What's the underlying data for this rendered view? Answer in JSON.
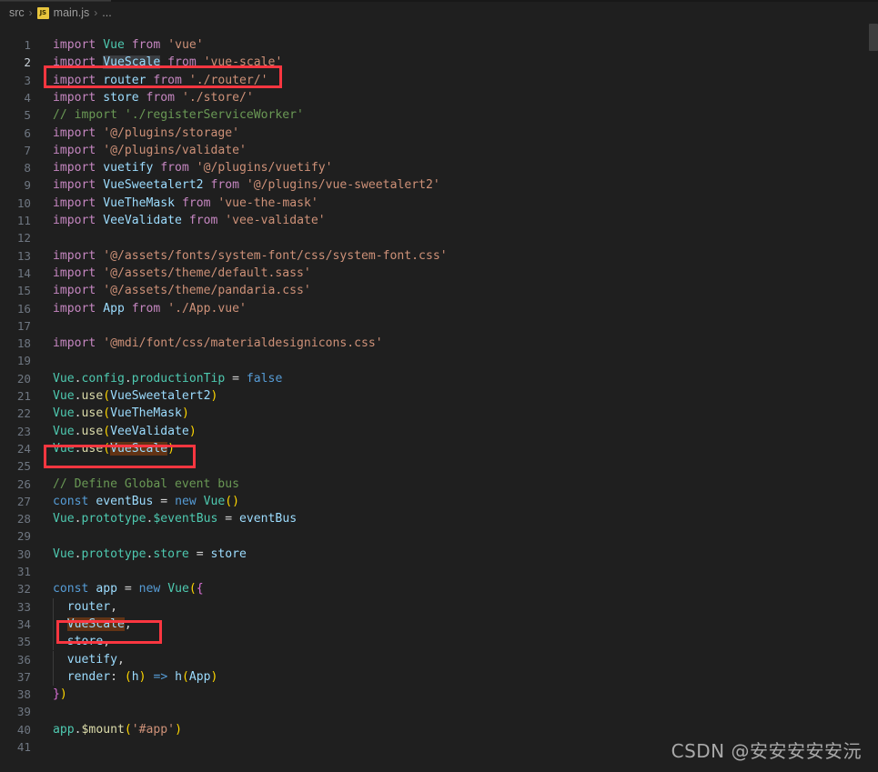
{
  "window": {
    "background_color": "#1f1f1f",
    "theme": "Dark+ (VS Code)"
  },
  "tabs": {
    "active_tab_label": "main.js"
  },
  "breadcrumb": {
    "items": [
      {
        "label": "src",
        "icon": null
      },
      {
        "label": "main.js",
        "icon": "js-file-icon"
      },
      {
        "label": "...",
        "icon": null
      }
    ],
    "separator": "›",
    "js_badge_text": "JS"
  },
  "editor": {
    "language": "javascript",
    "active_line": 2,
    "first_line": 1,
    "last_line": 41,
    "lines": [
      {
        "n": 1,
        "text": "import Vue from 'vue'"
      },
      {
        "n": 2,
        "text": "import VueScale from 'vue-scale'"
      },
      {
        "n": 3,
        "text": "import router from './router/'"
      },
      {
        "n": 4,
        "text": "import store from './store/'"
      },
      {
        "n": 5,
        "text": "// import './registerServiceWorker'"
      },
      {
        "n": 6,
        "text": "import '@/plugins/storage'"
      },
      {
        "n": 7,
        "text": "import '@/plugins/validate'"
      },
      {
        "n": 8,
        "text": "import vuetify from '@/plugins/vuetify'"
      },
      {
        "n": 9,
        "text": "import VueSweetalert2 from '@/plugins/vue-sweetalert2'"
      },
      {
        "n": 10,
        "text": "import VueTheMask from 'vue-the-mask'"
      },
      {
        "n": 11,
        "text": "import VeeValidate from 'vee-validate'"
      },
      {
        "n": 12,
        "text": ""
      },
      {
        "n": 13,
        "text": "import '@/assets/fonts/system-font/css/system-font.css'"
      },
      {
        "n": 14,
        "text": "import '@/assets/theme/default.sass'"
      },
      {
        "n": 15,
        "text": "import '@/assets/theme/pandaria.css'"
      },
      {
        "n": 16,
        "text": "import App from './App.vue'"
      },
      {
        "n": 17,
        "text": ""
      },
      {
        "n": 18,
        "text": "import '@mdi/font/css/materialdesignicons.css'"
      },
      {
        "n": 19,
        "text": ""
      },
      {
        "n": 20,
        "text": "Vue.config.productionTip = false"
      },
      {
        "n": 21,
        "text": "Vue.use(VueSweetalert2)"
      },
      {
        "n": 22,
        "text": "Vue.use(VueTheMask)"
      },
      {
        "n": 23,
        "text": "Vue.use(VeeValidate)"
      },
      {
        "n": 24,
        "text": "Vue.use(VueScale)"
      },
      {
        "n": 25,
        "text": ""
      },
      {
        "n": 26,
        "text": "// Define Global event bus"
      },
      {
        "n": 27,
        "text": "const eventBus = new Vue()"
      },
      {
        "n": 28,
        "text": "Vue.prototype.$eventBus = eventBus"
      },
      {
        "n": 29,
        "text": ""
      },
      {
        "n": 30,
        "text": "Vue.prototype.store = store"
      },
      {
        "n": 31,
        "text": ""
      },
      {
        "n": 32,
        "text": "const app = new Vue({"
      },
      {
        "n": 33,
        "text": "  router,"
      },
      {
        "n": 34,
        "text": "  VueScale,"
      },
      {
        "n": 35,
        "text": "  store,"
      },
      {
        "n": 36,
        "text": "  vuetify,"
      },
      {
        "n": 37,
        "text": "  render: (h) => h(App)"
      },
      {
        "n": 38,
        "text": "})"
      },
      {
        "n": 39,
        "text": ""
      },
      {
        "n": 40,
        "text": "app.$mount('#app')"
      },
      {
        "n": 41,
        "text": ""
      }
    ],
    "highlighted_token": "VueScale",
    "annotations": [
      {
        "label": "annotation-box-line-2",
        "line": 2,
        "color": "#fb3640"
      },
      {
        "label": "annotation-box-line-24",
        "line": 24,
        "color": "#fb3640"
      },
      {
        "label": "annotation-box-line-34",
        "line": 34,
        "color": "#fb3640"
      }
    ],
    "token_colors": {
      "keyword": "#c586c0",
      "identifier": "#9cdcfe",
      "string": "#ce9178",
      "comment": "#6a9955",
      "class": "#4ec9b0",
      "function": "#dcdcaa",
      "paren": "#ffd700",
      "brace": "#da70d6",
      "declaration": "#569cd6",
      "plain": "#d4d4d4"
    },
    "selection_colors": {
      "active_selection": "#3a3d41",
      "match_highlight": "#623315"
    }
  },
  "watermark": {
    "text": "CSDN @安安安安安沅"
  }
}
